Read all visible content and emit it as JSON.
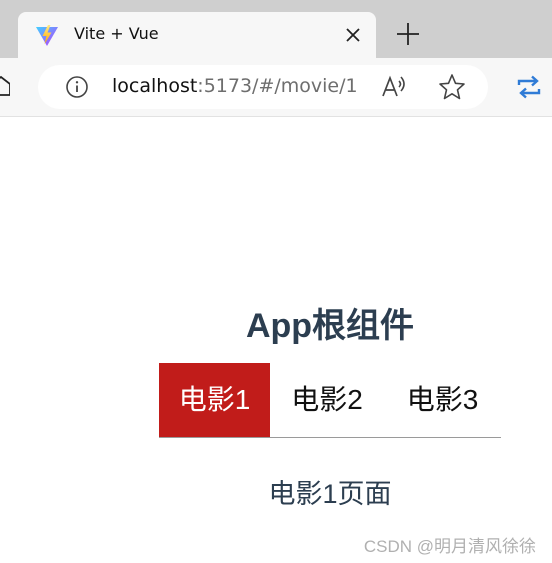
{
  "browser": {
    "tab_title": "Vite + Vue",
    "url_host": "localhost",
    "url_path": ":5173/#/movie/1",
    "icons": [
      "vite-logo-icon",
      "close-icon",
      "plus-icon",
      "home-icon",
      "info-icon",
      "read-aloud-icon",
      "star-icon",
      "sync-icon"
    ]
  },
  "page": {
    "title": "App根组件",
    "nav": [
      {
        "label": "电影1",
        "active": true
      },
      {
        "label": "电影2",
        "active": false
      },
      {
        "label": "电影3",
        "active": false
      }
    ],
    "view_text": "电影1页面",
    "accent_color": "#c11c1a",
    "text_color": "#2c3e50"
  },
  "watermark": "CSDN @明月清风徐徐"
}
